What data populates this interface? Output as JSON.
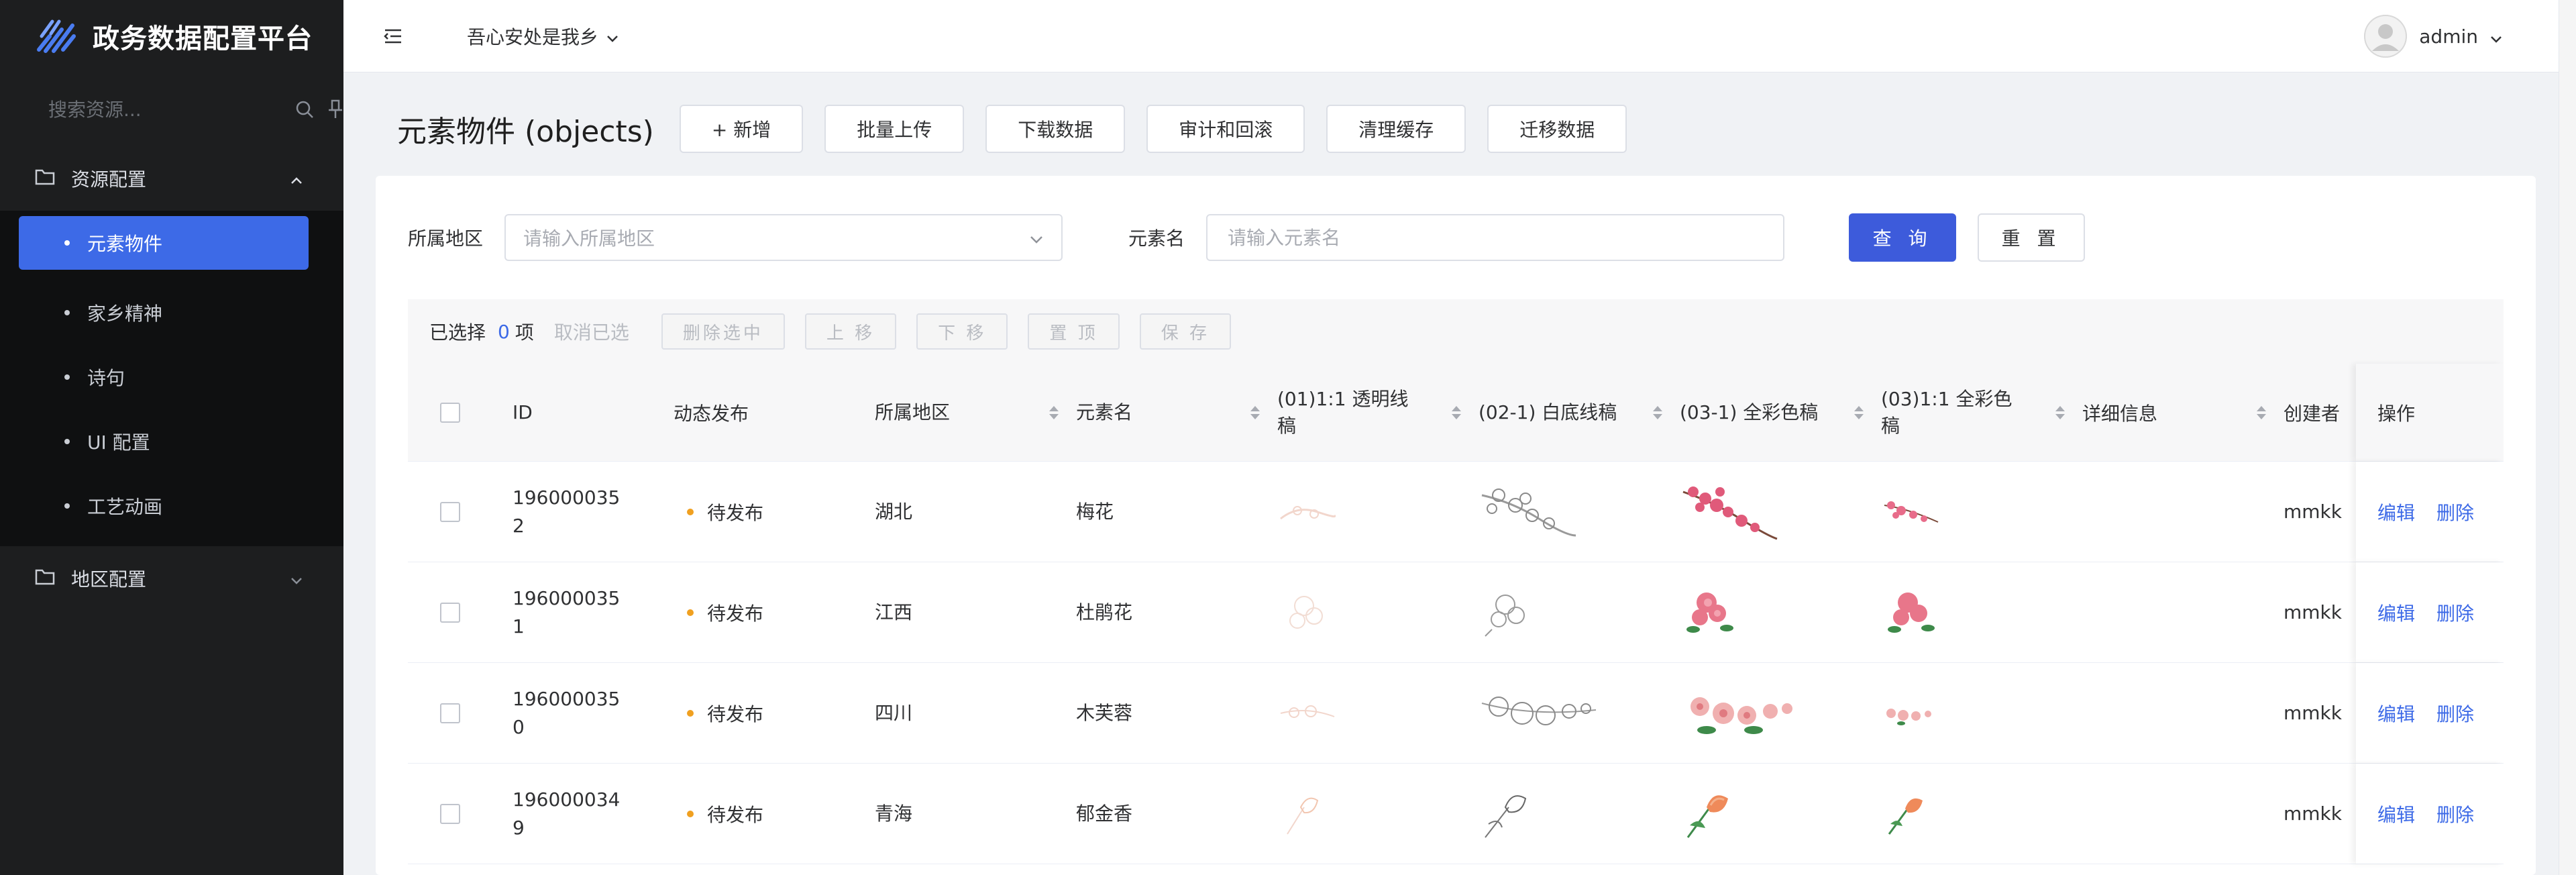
{
  "brand": {
    "title": "政务数据配置平台"
  },
  "sidebar": {
    "search_placeholder": "搜索资源...",
    "groups": [
      {
        "label": "资源配置",
        "expanded": true,
        "items": [
          {
            "label": "元素物件",
            "active": true
          },
          {
            "label": "家乡精神"
          },
          {
            "label": "诗句"
          },
          {
            "label": "UI 配置"
          },
          {
            "label": "工艺动画"
          }
        ]
      },
      {
        "label": "地区配置",
        "expanded": false
      }
    ]
  },
  "header": {
    "region": "吾心安处是我乡",
    "user": "admin"
  },
  "page": {
    "title": "元素物件 (objects)",
    "actions": [
      "+ 新增",
      "批量上传",
      "下载数据",
      "审计和回滚",
      "清理缓存",
      "迁移数据"
    ]
  },
  "filters": {
    "region_label": "所属地区",
    "region_placeholder": "请输入所属地区",
    "name_label": "元素名",
    "name_placeholder": "请输入元素名",
    "query": "查 询",
    "reset": "重 置"
  },
  "selection": {
    "prefix": "已选择",
    "count": "0",
    "suffix": "项",
    "cancel": "取消已选",
    "buttons": [
      "删除选中",
      "上 移",
      "下 移",
      "置 顶",
      "保 存"
    ]
  },
  "table": {
    "columns": [
      "ID",
      "动态发布",
      "所属地区",
      "元素名",
      "(01)1:1 透明线稿",
      "(02-1) 白底线稿",
      "(03-1) 全彩色稿",
      "(03)1:1 全彩色稿",
      "详细信息",
      "创建者",
      "操作"
    ],
    "rows": [
      {
        "id_line1": "196000035",
        "id_line2": "2",
        "status": "待发布",
        "region": "湖北",
        "name": "梅花",
        "creator": "mmkk",
        "edit": "编辑",
        "delete": "删除"
      },
      {
        "id_line1": "196000035",
        "id_line2": "1",
        "status": "待发布",
        "region": "江西",
        "name": "杜鹃花",
        "creator": "mmkk",
        "edit": "编辑",
        "delete": "删除"
      },
      {
        "id_line1": "196000035",
        "id_line2": "0",
        "status": "待发布",
        "region": "四川",
        "name": "木芙蓉",
        "creator": "mmkk",
        "edit": "编辑",
        "delete": "删除"
      },
      {
        "id_line1": "196000034",
        "id_line2": "9",
        "status": "待发布",
        "region": "青海",
        "name": "郁金香",
        "creator": "mmkk",
        "edit": "编辑",
        "delete": "删除"
      }
    ]
  },
  "colors": {
    "accent": "#3d6ae7",
    "primary_button": "#3d5bdb",
    "sidebar": "#1d1e1f",
    "pending": "#f0a020"
  },
  "icons": [
    "logo-icon",
    "search-icon",
    "pin-icon",
    "folder-icon",
    "chevron-up-icon",
    "chevron-down-icon",
    "menu-fold-icon",
    "avatar-icon",
    "sort-icon"
  ]
}
